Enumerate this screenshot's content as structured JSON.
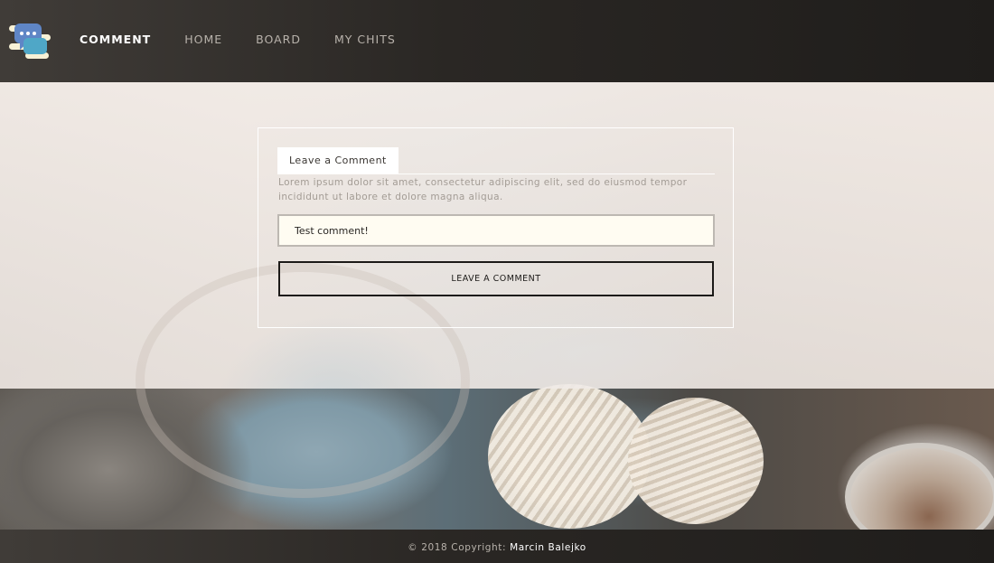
{
  "header": {
    "logo_icon": "chat-bubbles-logo-icon",
    "nav": [
      {
        "label": "COMMENT",
        "active": true
      },
      {
        "label": "HOME",
        "active": false
      },
      {
        "label": "BOARD",
        "active": false
      },
      {
        "label": "MY CHITS",
        "active": false
      }
    ]
  },
  "comment_form": {
    "title": "Leave a Comment",
    "description": "Lorem ipsum dolor sit amet, consectetur adipiscing elit, sed do eiusmod tempor incididunt ut labore et dolore magna aliqua.",
    "input_value": "Test comment!",
    "button_label": "LEAVE A COMMENT"
  },
  "footer": {
    "copyright_prefix": "© 2018 Copyright:",
    "author": "Marcin Balejko"
  },
  "colors": {
    "header_bg": "#2a2724",
    "nav_active": "#ffffff",
    "nav_inactive": "#b8b2ab",
    "input_bg": "#fffcf2"
  }
}
